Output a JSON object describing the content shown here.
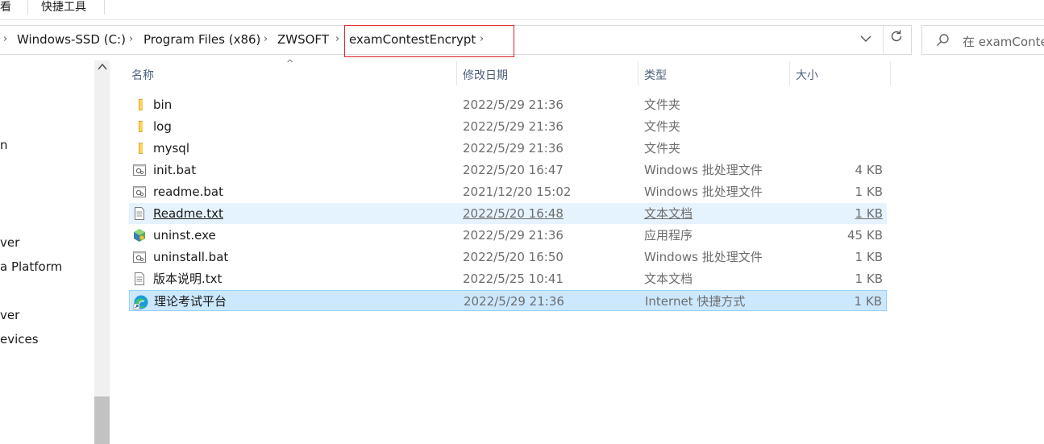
{
  "ribbon": {
    "tabs": [
      "看",
      "快捷工具"
    ]
  },
  "address": {
    "crumbs": [
      "Windows-SSD (C:)",
      "Program Files (x86)",
      "ZWSOFT",
      "examContestEncrypt"
    ]
  },
  "search": {
    "placeholder": "在 examConte"
  },
  "nav": {
    "items": [
      "n",
      "ver",
      "a Platform",
      "ver",
      "evices"
    ]
  },
  "columns": {
    "name": "名称",
    "date": "修改日期",
    "type": "类型",
    "size": "大小"
  },
  "files": [
    {
      "name": "bin",
      "date": "2022/5/29 21:36",
      "type": "文件夹",
      "size": "",
      "icon": "folder-icon"
    },
    {
      "name": "log",
      "date": "2022/5/29 21:36",
      "type": "文件夹",
      "size": "",
      "icon": "folder-icon"
    },
    {
      "name": "mysql",
      "date": "2022/5/29 21:36",
      "type": "文件夹",
      "size": "",
      "icon": "folder-icon"
    },
    {
      "name": "init.bat",
      "date": "2022/5/20 16:47",
      "type": "Windows 批处理文件",
      "size": "4 KB",
      "icon": "batch-file-icon"
    },
    {
      "name": "readme.bat",
      "date": "2021/12/20 15:02",
      "type": "Windows 批处理文件",
      "size": "1 KB",
      "icon": "batch-file-icon"
    },
    {
      "name": "Readme.txt",
      "date": "2022/5/20 16:48",
      "type": "文本文档",
      "size": "1 KB",
      "icon": "text-file-icon"
    },
    {
      "name": "uninst.exe",
      "date": "2022/5/29 21:36",
      "type": "应用程序",
      "size": "45 KB",
      "icon": "installer-icon"
    },
    {
      "name": "uninstall.bat",
      "date": "2022/5/20 16:50",
      "type": "Windows 批处理文件",
      "size": "1 KB",
      "icon": "batch-file-icon"
    },
    {
      "name": "版本说明.txt",
      "date": "2022/5/25 10:41",
      "type": "文本文档",
      "size": "1 KB",
      "icon": "text-file-icon"
    },
    {
      "name": "理论考试平台",
      "date": "2022/5/29 21:36",
      "type": "Internet 快捷方式",
      "size": "1 KB",
      "icon": "edge-shortcut-icon"
    }
  ],
  "colors": {
    "highlight_box": "#e0242a",
    "selected_row": "#cce8ff",
    "hover_row": "#e5f3ff"
  }
}
